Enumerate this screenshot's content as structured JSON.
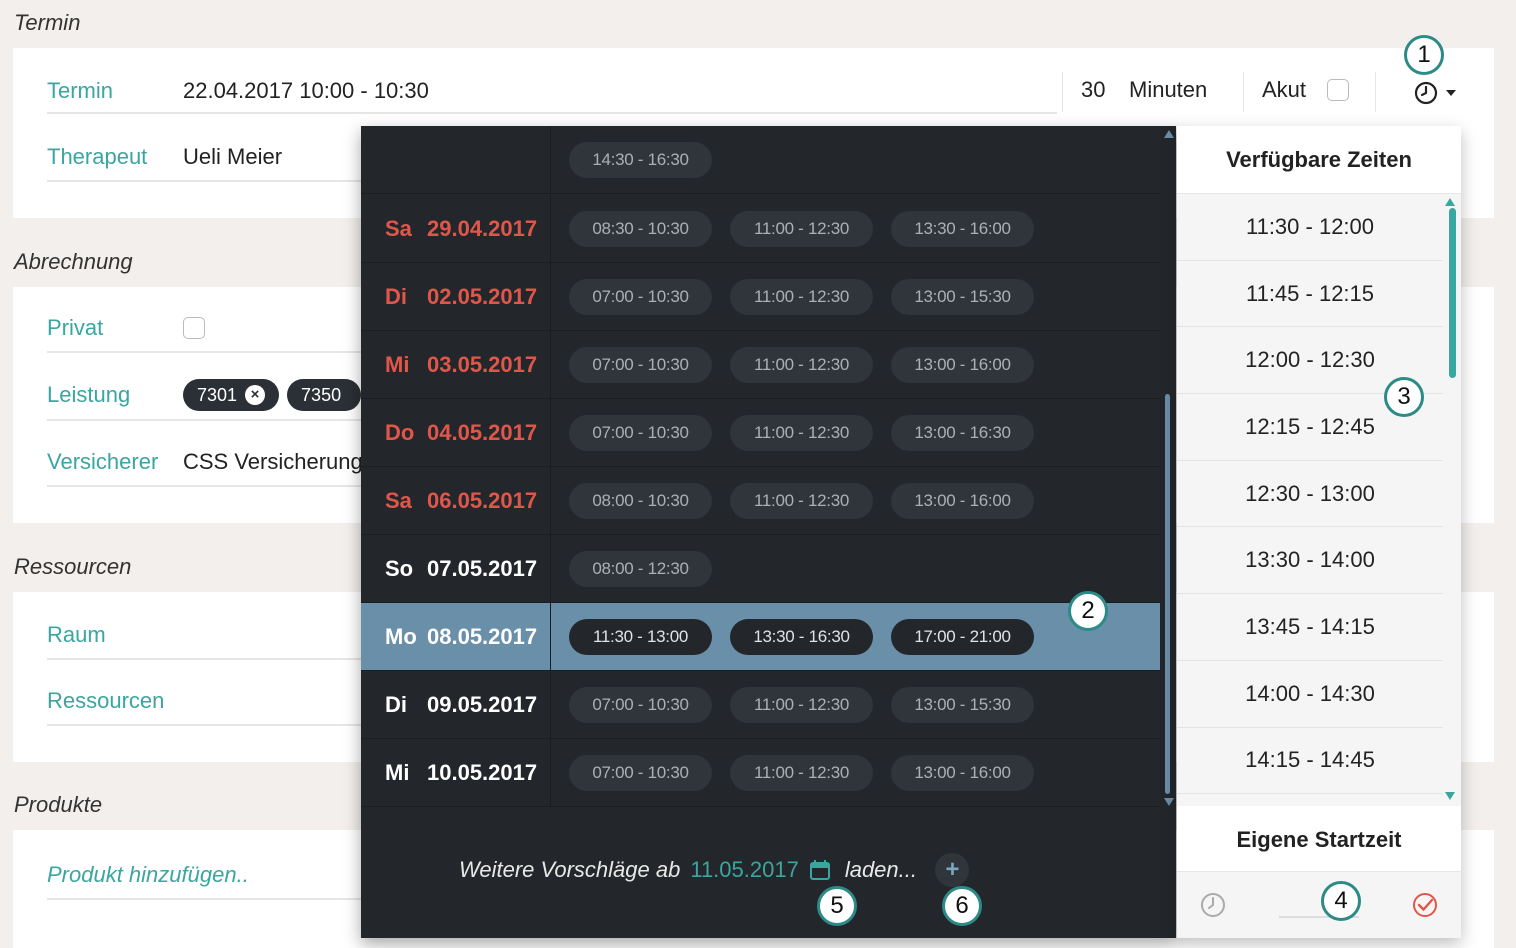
{
  "sections": {
    "termin": "Termin",
    "abrechnung": "Abrechnung",
    "ressourcen": "Ressourcen",
    "produkte": "Produkte"
  },
  "termin": {
    "label": "Termin",
    "value": "22.04.2017 10:00 - 10:30",
    "duration": "30",
    "duration_unit": "Minuten",
    "akut_label": "Akut",
    "therapeut_label": "Therapeut",
    "therapeut_value": "Ueli  Meier"
  },
  "abrechnung": {
    "privat_label": "Privat",
    "leistung_label": "Leistung",
    "leistung_chips": [
      "7301",
      "7350"
    ],
    "versicherer_label": "Versicherer",
    "versicherer_value": "CSS Versicherung"
  },
  "ressourcen": {
    "raum_label": "Raum",
    "ressourcen_label": "Ressourcen"
  },
  "produkte": {
    "placeholder": "Produkt hinzufügen.."
  },
  "suggestions": {
    "first_row_slots": [
      "14:30 - 16:30"
    ],
    "days": [
      {
        "weekday": "Sa",
        "date": "29.04.2017",
        "color": "red",
        "slots": [
          "08:30 - 10:30",
          "11:00 - 12:30",
          "13:30 - 16:00"
        ]
      },
      {
        "weekday": "Di",
        "date": "02.05.2017",
        "color": "red",
        "slots": [
          "07:00 - 10:30",
          "11:00 - 12:30",
          "13:00 - 15:30"
        ]
      },
      {
        "weekday": "Mi",
        "date": "03.05.2017",
        "color": "red",
        "slots": [
          "07:00 - 10:30",
          "11:00 - 12:30",
          "13:00 - 16:00"
        ]
      },
      {
        "weekday": "Do",
        "date": "04.05.2017",
        "color": "red",
        "slots": [
          "07:00 - 10:30",
          "11:00 - 12:30",
          "13:00 - 16:30"
        ]
      },
      {
        "weekday": "Sa",
        "date": "06.05.2017",
        "color": "red",
        "slots": [
          "08:00 - 10:30",
          "11:00 - 12:30",
          "13:00 - 16:00"
        ]
      },
      {
        "weekday": "So",
        "date": "07.05.2017",
        "color": "white",
        "slots": [
          "08:00 - 12:30"
        ]
      },
      {
        "weekday": "Mo",
        "date": "08.05.2017",
        "color": "white",
        "selected": true,
        "slots": [
          "11:30 - 13:00",
          "13:30 - 16:30",
          "17:00 - 21:00"
        ]
      },
      {
        "weekday": "Di",
        "date": "09.05.2017",
        "color": "white",
        "slots": [
          "07:00 - 10:30",
          "11:00 - 12:30",
          "13:00 - 15:30"
        ]
      },
      {
        "weekday": "Mi",
        "date": "10.05.2017",
        "color": "white",
        "slots": [
          "07:00 - 10:30",
          "11:00 - 12:30",
          "13:00 - 16:00"
        ]
      }
    ],
    "footer_prefix": "Weitere Vorschläge ab",
    "footer_date": "11.05.2017",
    "footer_suffix": "laden...",
    "plus": "+"
  },
  "available": {
    "title": "Verfügbare Zeiten",
    "times": [
      "11:30 - 12:00",
      "11:45 - 12:15",
      "12:00 - 12:30",
      "12:15 - 12:45",
      "12:30 - 13:00",
      "13:30 - 14:00",
      "13:45 - 14:15",
      "14:00 - 14:30",
      "14:15 - 14:45"
    ],
    "own_start_title": "Eigene Startzeit"
  },
  "badges": [
    "1",
    "2",
    "3",
    "4",
    "5",
    "6"
  ],
  "colors": {
    "accent": "#3aa6a0",
    "weekend_red": "#e0574a",
    "selected_row": "#6a8fa8",
    "dark_panel": "#23272c"
  }
}
